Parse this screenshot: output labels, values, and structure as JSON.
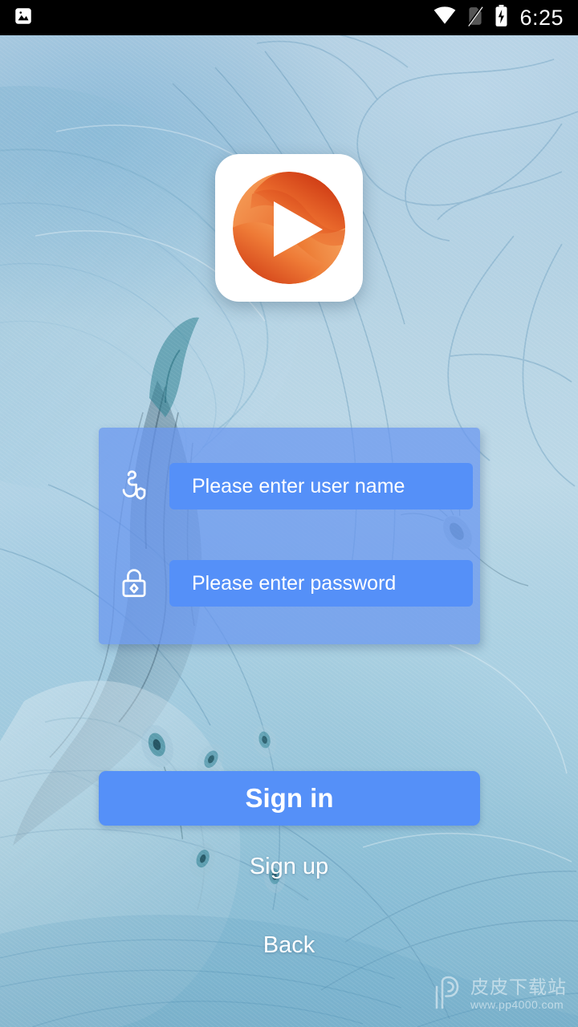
{
  "status_bar": {
    "time": "6:25",
    "icons": {
      "screenshot": "image-icon",
      "wifi": "wifi-icon",
      "sim": "no-sim-card-icon",
      "battery": "battery-charging-icon"
    }
  },
  "app": {
    "logo_name": "media-player-logo",
    "logo_colors": {
      "orange_light": "#f59a53",
      "orange_mid": "#ee6f31",
      "orange_dark": "#d8401a",
      "card_bg": "#ffffff"
    }
  },
  "login_form": {
    "panel_color": "#6896f0",
    "username": {
      "icon": "user-icon",
      "placeholder": "Please enter user name",
      "value": ""
    },
    "password": {
      "icon": "lock-icon",
      "placeholder": "Please enter password",
      "value": ""
    }
  },
  "actions": {
    "sign_in_label": "Sign in",
    "sign_up_label": "Sign up",
    "back_label": "Back",
    "accent_color": "#5590f8"
  },
  "watermark": {
    "title": "皮皮下载站",
    "url": "www.pp4000.com",
    "logo_name": "pp-watermark-logo"
  }
}
